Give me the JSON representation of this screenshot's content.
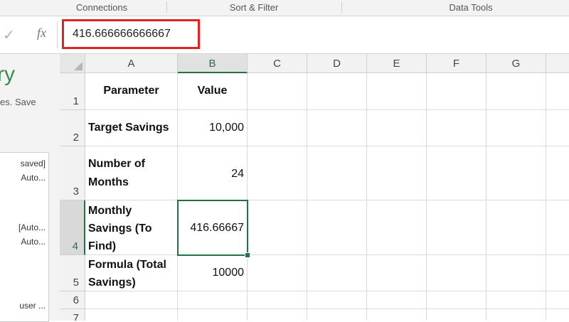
{
  "ribbon": {
    "groups": [
      "Connections",
      "Sort & Filter",
      "Data Tools"
    ]
  },
  "formula_bar": {
    "fx_label": "fx",
    "value": "416.666666666667"
  },
  "side_panel": {
    "title_fragment": "ry",
    "subtitle_fragment": "es. Save",
    "items": [
      "saved]",
      "Auto...",
      "[Auto...",
      "Auto...",
      "user ..."
    ]
  },
  "sheet": {
    "columns": [
      "A",
      "B",
      "C",
      "D",
      "E",
      "F",
      "G"
    ],
    "selected_column": "B",
    "rows": [
      "1",
      "2",
      "3",
      "4",
      "5",
      "6",
      "7"
    ],
    "selected_row": "4",
    "cells": {
      "A1": "Parameter",
      "B1": "Value",
      "A2": "Target Savings",
      "B2": "10,000",
      "A3": "Number of Months",
      "B3": "24",
      "A4": "Monthly Savings (To Find)",
      "B4": "416.66667",
      "A5": "Formula (Total Savings)",
      "B5": "10000"
    },
    "active_cell": "B4"
  },
  "colors": {
    "excel_green": "#217346",
    "highlight_red": "#e02323"
  }
}
